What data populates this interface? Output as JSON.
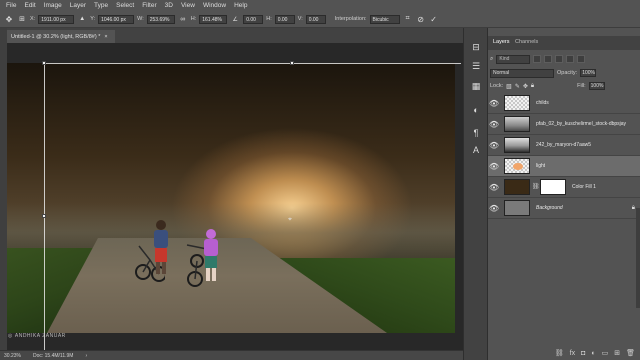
{
  "menu": [
    "File",
    "Edit",
    "Image",
    "Layer",
    "Type",
    "Select",
    "Filter",
    "3D",
    "View",
    "Window",
    "Help"
  ],
  "options": {
    "x_label": "X:",
    "x_value": "1911.00 px",
    "y_label": "Y:",
    "y_value": "1046.00 px",
    "w_label": "W:",
    "w_value": "253.69%",
    "h_label": "H:",
    "h_value": "161.48%",
    "angle_value": "0.00",
    "h_skew_label": "H:",
    "h_skew_value": "0.00",
    "v_skew_label": "V:",
    "v_skew_value": "0.00",
    "interp_label": "Interpolation:",
    "interp_value": "Bicubic"
  },
  "document": {
    "tab_title": "Untitled-1 @ 30.2% (light, RGB/8#) *",
    "close_glyph": "×"
  },
  "watermark": "ANDHIKA ZANUAR",
  "status": {
    "zoom": "30.23%",
    "doc": "Doc: 15.4M/11.9M"
  },
  "panel": {
    "tabs": [
      "Layers",
      "Channels"
    ],
    "kind_label": "Kind",
    "blend_mode": "Normal",
    "opacity_label": "Opacity:",
    "opacity_value": "100%",
    "lock_label": "Lock:",
    "fill_label": "Fill:",
    "fill_value": "100%"
  },
  "layers": [
    {
      "name": "childs",
      "italic": false,
      "selected": false
    },
    {
      "name": "pfab_02_by_kuschelirmel_stock-dbpsjay",
      "italic": false,
      "selected": false
    },
    {
      "name": "242_by_maryon-d7aaw5",
      "italic": false,
      "selected": false
    },
    {
      "name": "light",
      "italic": false,
      "selected": true
    },
    {
      "name": "Color Fill 1",
      "italic": false,
      "selected": false
    },
    {
      "name": "Background",
      "italic": true,
      "selected": false
    }
  ],
  "colors": {
    "ui_bg": "#535353",
    "selected_layer": "#6c6c6c",
    "canvas_bg": "#282828"
  }
}
